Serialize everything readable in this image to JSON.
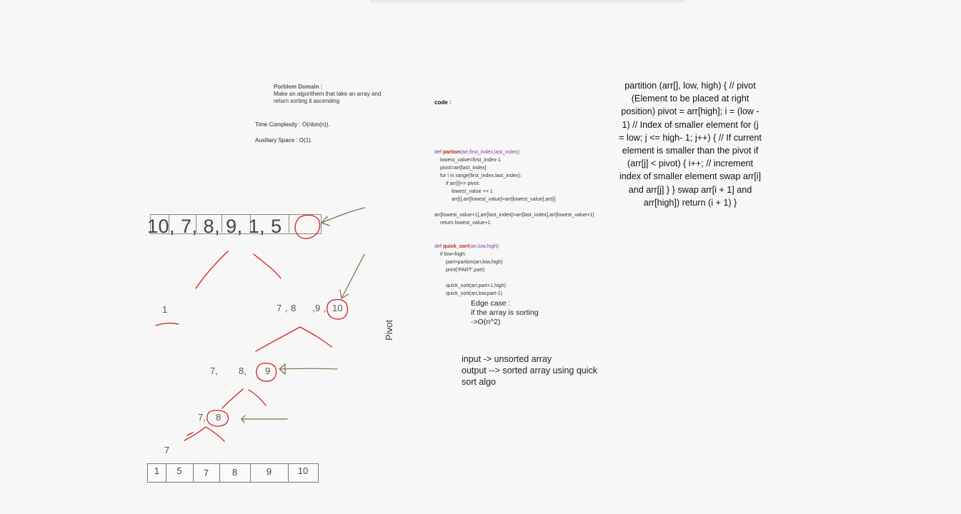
{
  "problem": {
    "heading": "Porblem Domain :",
    "line1": "Make an algorithem  that take an array and",
    "line2": "return sorting it ascending"
  },
  "complexity": {
    "time": "Time Complexity : O(nlon(n)).",
    "auxiliary": "Auxiliary Space : O(1)."
  },
  "code": {
    "title": "code :",
    "lines": [
      "def partion(arr,first_index,last_index):",
      "    lowest_value=first_index-1",
      "    pivot=arr[last_index]",
      "    for i in range(first_index,last_index):",
      "        if arr[i]<= pivot:",
      "            lowest_value += 1",
      "            arr[i],arr[lowest_value]=arr[lowest_value],arr[i]",
      "",
      "arr[lowest_value+1],arr[last_index]=arr[last_index],arr[lowest_value+1]",
      "    return lowest_value+1",
      "",
      "",
      "def quick_sort(arr,low,high):",
      "    if low<high:",
      "        part=partion(arr,low,high)",
      "        print('PART',part)",
      "",
      "        quick_sort(arr,part+1,high)",
      "        quick_sort(arr,low,part-1)"
    ]
  },
  "partition_text": "partition (arr[], low, high) {     // pivot (Element to be placed at right position)     pivot = arr[high]; i = (low - 1)  // Index of smaller element      for (j = low; j <= high- 1; j++)     {         // If current element is smaller than the pivot         if (arr[j] < pivot)         {             i++;    // increment index of smaller element             swap arr[i] and arr[j]         }     }     swap arr[i + 1] and arr[high])     return (i + 1) }",
  "array": {
    "values": [
      "10",
      "7",
      "8",
      "9",
      "1",
      "5"
    ],
    "text": "10, 7,  8,  9,  1, 5"
  },
  "tree": {
    "left_node": "1",
    "right_node": "7 , 8     ,9 ,",
    "right_pivot": "10",
    "level2_a": "7,",
    "level2_b": "8,",
    "level2_pivot": "9",
    "level3": "7,",
    "level3_pivot": "8",
    "level4": "7"
  },
  "pivot_label": "Pivot",
  "edge_case": {
    "line1": "Edge case :",
    "line2": "if the array is sorting",
    "line3": "->O(n^2)"
  },
  "io": {
    "input": "input -> unsorted array",
    "output": "output --> sorted array using quick",
    "output2": "sort algo"
  },
  "sorted": [
    "1",
    "5",
    "7",
    "8",
    "9",
    "10"
  ],
  "colors": {
    "ink_red": "#d81e1e",
    "ink_olive": "#7a6e48"
  }
}
